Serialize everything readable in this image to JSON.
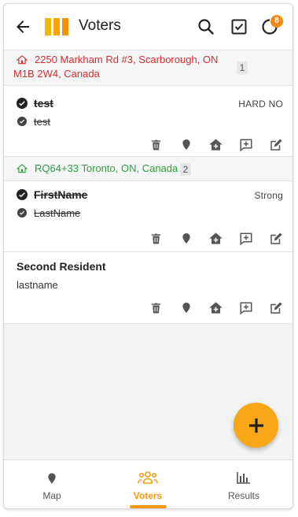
{
  "header": {
    "title": "Voters",
    "notification_count": "8"
  },
  "groups": [
    {
      "address_line1": "2250 Markham Rd #3, Scarborough, ON",
      "address_line2": "M1B 2W4, Canada",
      "count": "1",
      "color": "#d32f2f",
      "residents": [
        {
          "first_name": "test",
          "last_name": "test",
          "support": "HARD NO",
          "voted": true
        }
      ]
    },
    {
      "address_line1": "RQ64+33 Toronto, ON, Canada",
      "count": "2",
      "color": "#2e9e3e",
      "residents": [
        {
          "first_name": "FirstName",
          "last_name": "LastName",
          "support": "Strong",
          "voted": true
        },
        {
          "first_name": "Second Resident",
          "last_name": "lastname",
          "support": "",
          "voted": false
        }
      ]
    }
  ],
  "icons": {
    "back": "arrow-left-icon",
    "search": "search-icon",
    "checklist": "checkbox-icon",
    "sync": "sync-icon",
    "delete": "trash-icon",
    "location": "map-marker-icon",
    "home_add": "home-plus-icon",
    "comment": "comment-plus-icon",
    "edit": "edit-icon",
    "add": "plus-icon"
  },
  "bottom_nav": {
    "tabs": [
      {
        "label": "Map",
        "active": false
      },
      {
        "label": "Voters",
        "active": true
      },
      {
        "label": "Results",
        "active": false
      }
    ]
  },
  "colors": {
    "accent": "#f29a14",
    "fab": "#f7a616",
    "address_red": "#d32f2f",
    "address_green": "#2e9e3e"
  }
}
